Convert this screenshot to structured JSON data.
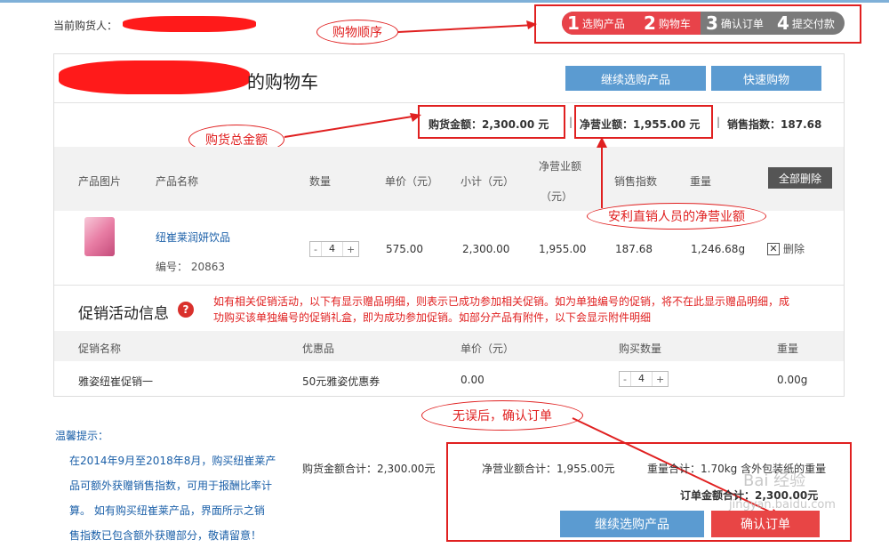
{
  "header": {
    "buyer_label": "当前购货人：",
    "steps": [
      {
        "num": "1",
        "label": "选购产品"
      },
      {
        "num": "2",
        "label": "购物车"
      },
      {
        "num": "3",
        "label": "确认订单"
      },
      {
        "num": "4",
        "label": "提交付款"
      }
    ]
  },
  "annotations": {
    "order": "购物顺序",
    "total": "购货总金额",
    "net": "安利直销人员的净营业额",
    "confirm": "无误后，确认订单"
  },
  "cart": {
    "title_suffix": "的购物车",
    "continue_btn": "继续选购产品",
    "quick_btn": "快速购物",
    "total_label": "购货金额：",
    "total_value": "2,300.00 元",
    "net_label": "净营业额：",
    "net_value": "1,955.00 元",
    "sales_label": "销售指数：",
    "sales_value": "187.68",
    "columns": [
      "产品图片",
      "产品名称",
      "数量",
      "单价（元）",
      "小计（元）",
      "净营业额",
      "（元）",
      "销售指数",
      "重量"
    ],
    "delete_all": "全部删除",
    "item": {
      "name": "纽崔莱润妍饮品",
      "code": "编号： 20863",
      "qty": "4",
      "price": "575.00",
      "subtotal": "2,300.00",
      "net": "1,955.00",
      "sales": "187.68",
      "weight": "1,246.68g",
      "delete": "删除"
    }
  },
  "promo": {
    "title": "促销活动信息",
    "notice_line1": "如有相关促销活动，以下有显示赠品明细，则表示已成功参加相关促销。如为单独编号的促销，将不在此显示赠品明细，成",
    "notice_line2": "功购买该单独编号的促销礼盒，即为成功参加促销。如部分产品有附件，以下会显示附件明细",
    "columns": [
      "促销名称",
      "优惠品",
      "单价（元）",
      "购买数量",
      "重量"
    ],
    "row": {
      "name": "雅姿纽崔促销一",
      "gift": "50元雅姿优惠券",
      "price": "0.00",
      "qty": "4",
      "weight": "0.00g"
    }
  },
  "tips": {
    "title": "温馨提示：",
    "lines": [
      "在2014年9月至2018年8月，购买纽崔莱产",
      "品可额外获赠销售指数，可用于报酬比率计",
      "算。 如有购买纽崔莱产品，界面所示之销",
      "售指数已包含额外获赠部分，敬请留意！"
    ]
  },
  "footer": {
    "total": "购货金额合计：2,300.00元",
    "net": "净营业额合计：1,955.00元",
    "weight": "重量合计：1.70kg 含外包装纸的重量",
    "order_total": "订单金额合计：2,300.00元",
    "continue_btn": "继续选购产品",
    "confirm_btn": "确认订单"
  },
  "watermark": {
    "brand": "Bai 经验",
    "url": "jingyan.baidu.com"
  }
}
